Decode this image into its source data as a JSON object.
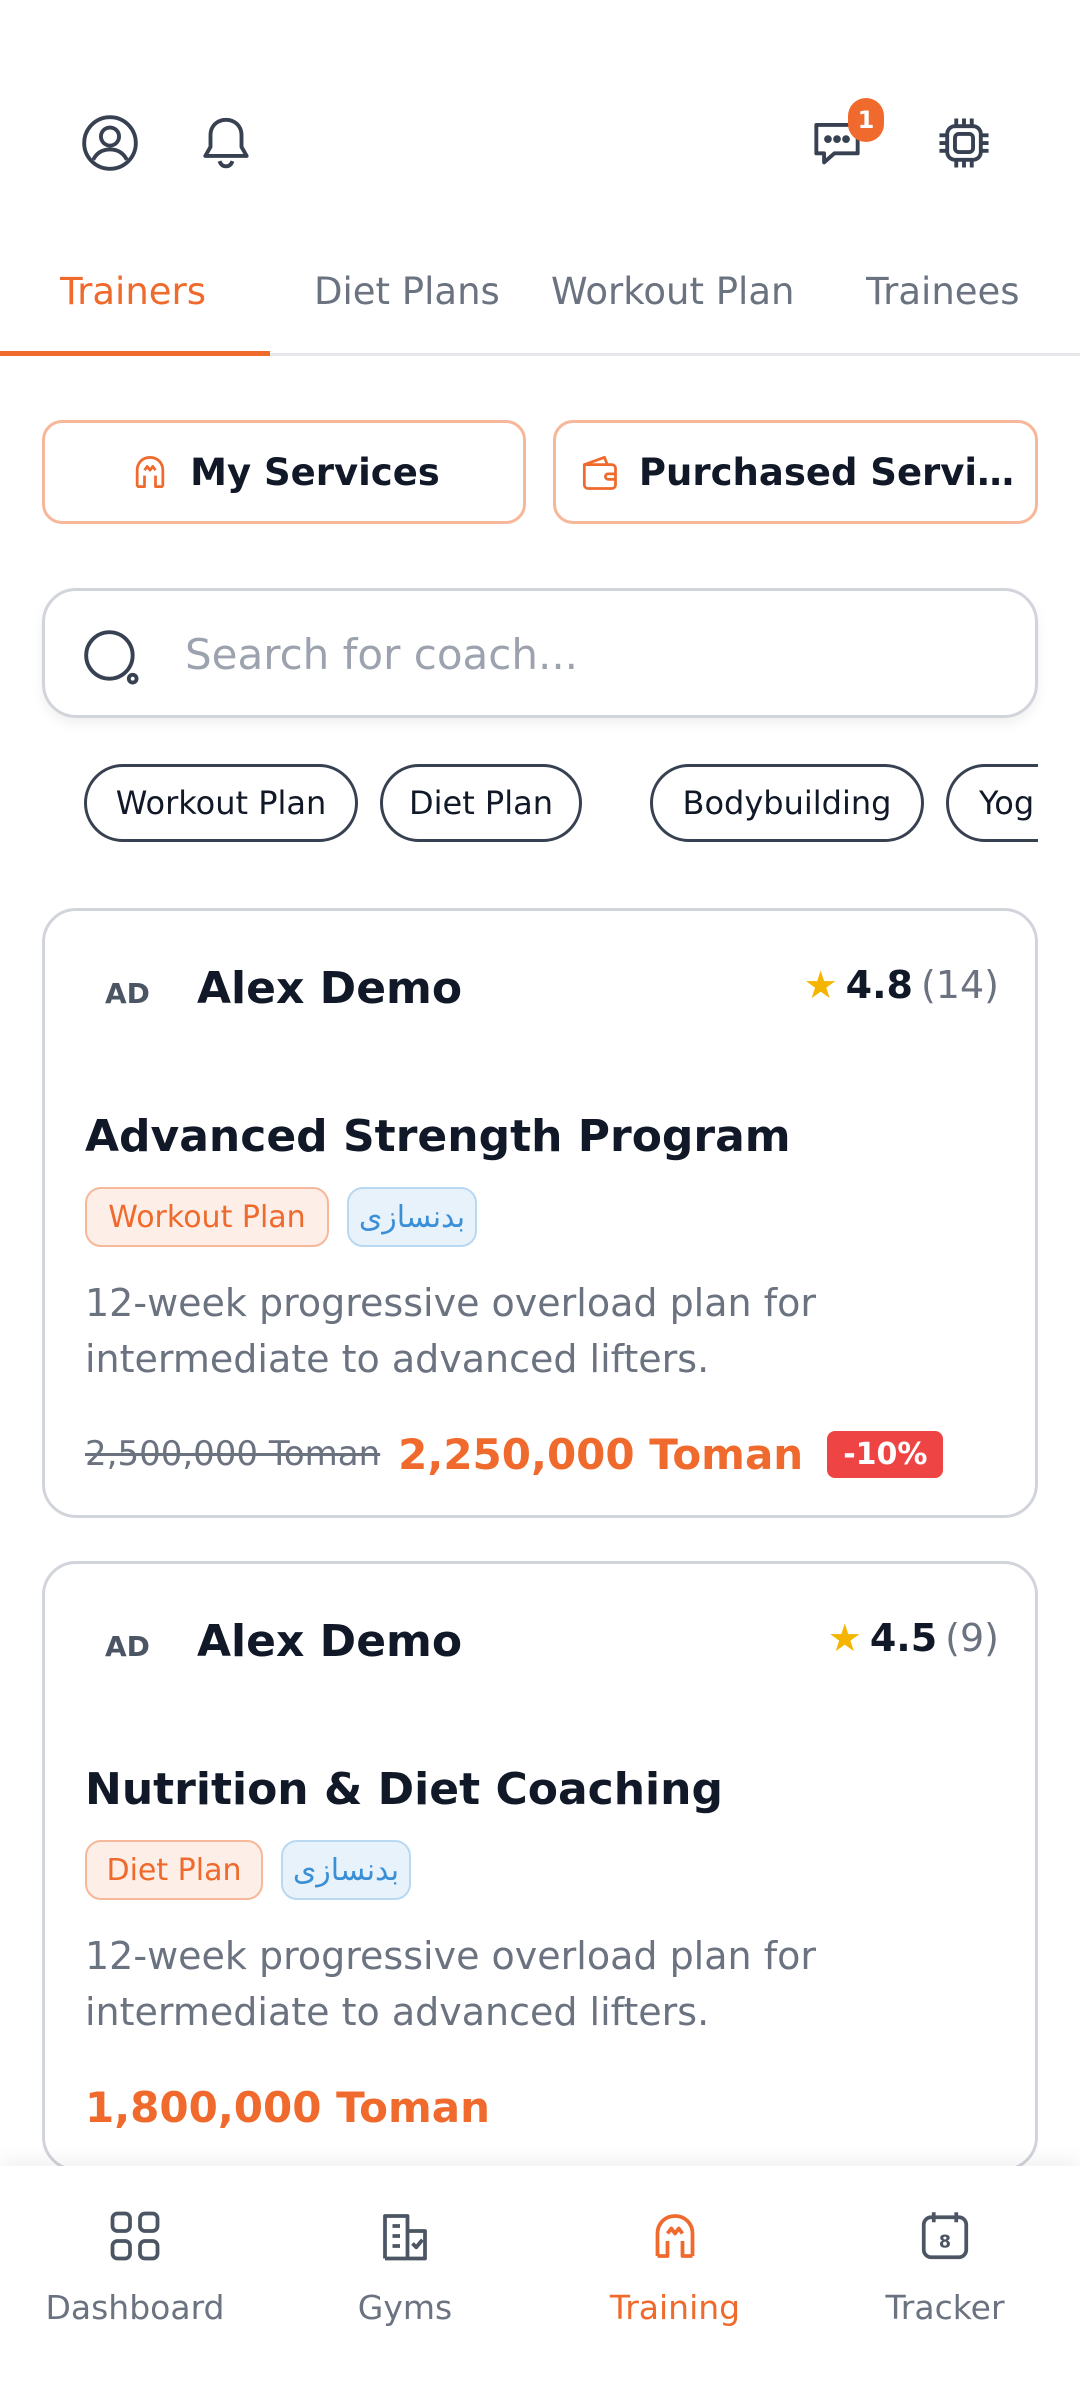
{
  "header": {
    "profile_icon": "user-circle-icon",
    "notification_icon": "bell-icon",
    "chat_icon": "chat-bubble-icon",
    "chat_badge": "1",
    "ai_icon": "chip-icon"
  },
  "tabs": [
    {
      "label": "Trainers",
      "active": true
    },
    {
      "label": "Diet Plans",
      "active": false
    },
    {
      "label": "Workout Plan",
      "active": false
    },
    {
      "label": "Trainees",
      "active": false
    }
  ],
  "service_buttons": {
    "my_services": "My Services",
    "purchased_services": "Purchased Servi…"
  },
  "search": {
    "placeholder": "Search for coach..."
  },
  "chips": [
    "Workout Plan",
    "Diet Plan",
    "Bodybuilding",
    "Yog"
  ],
  "cards": [
    {
      "initials": "AD",
      "trainer_name": "Alex Demo",
      "rating": "4.8",
      "rating_count": "(14)",
      "title": "Advanced Strength Program",
      "type_tag": "Workout Plan",
      "category_tag": "بدنسازی",
      "description": "12-week progressive overload plan for intermediate to advanced lifters.",
      "old_price": "2,500,000 Toman",
      "price": "2,250,000 Toman",
      "discount": "-10%"
    },
    {
      "initials": "AD",
      "trainer_name": "Alex Demo",
      "rating": "4.5",
      "rating_count": "(9)",
      "title": "Nutrition & Diet Coaching",
      "type_tag": "Diet Plan",
      "category_tag": "بدنسازی",
      "description": "12-week progressive overload plan for intermediate to advanced lifters.",
      "price": "1,800,000 Toman"
    }
  ],
  "bottom_nav": [
    {
      "label": "Dashboard",
      "icon": "grid-icon",
      "active": false
    },
    {
      "label": "Gyms",
      "icon": "building-icon",
      "active": false
    },
    {
      "label": "Training",
      "icon": "dumbbell-icon",
      "active": true
    },
    {
      "label": "Tracker",
      "icon": "calendar-icon",
      "active": false
    }
  ],
  "colors": {
    "accent": "#ef6a2c",
    "discount": "#ef4444",
    "star": "#f5b400"
  }
}
